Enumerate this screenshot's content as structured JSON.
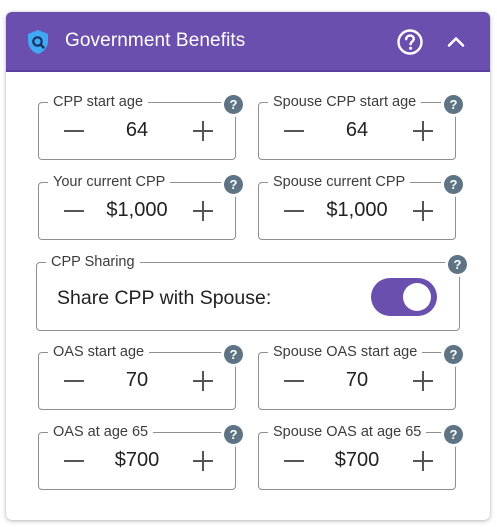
{
  "header": {
    "title": "Government Benefits",
    "icon": "shield-icon",
    "help_icon": "help-circle-icon",
    "collapse_icon": "chevron-up-icon",
    "color": "#6b4fae"
  },
  "fields": {
    "cpp_start_age": {
      "label": "CPP start age",
      "value": "64"
    },
    "spouse_cpp_start_age": {
      "label": "Spouse CPP start age",
      "value": "64"
    },
    "your_current_cpp": {
      "label": "Your current CPP",
      "value": "$1,000"
    },
    "spouse_current_cpp": {
      "label": "Spouse current CPP",
      "value": "$1,000"
    },
    "oas_start_age": {
      "label": "OAS start age",
      "value": "70"
    },
    "spouse_oas_start_age": {
      "label": "Spouse OAS start age",
      "value": "70"
    },
    "oas_at_age_65": {
      "label": "OAS at age 65",
      "value": "$700"
    },
    "spouse_oas_at_age_65": {
      "label": "Spouse OAS at age 65",
      "value": "$700"
    }
  },
  "cpp_sharing": {
    "label": "CPP Sharing",
    "text": "Share CPP with Spouse:",
    "enabled": true
  },
  "info_glyph": "?"
}
